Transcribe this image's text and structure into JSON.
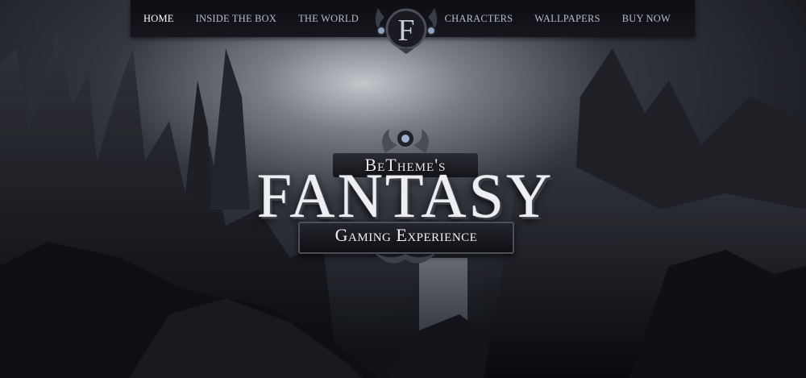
{
  "nav": {
    "left": [
      {
        "label": "HOME",
        "active": true
      },
      {
        "label": "INSIDE THE BOX",
        "active": false
      },
      {
        "label": "THE WORLD",
        "active": false
      }
    ],
    "right": [
      {
        "label": "CHARACTERS",
        "active": false
      },
      {
        "label": "WALLPAPERS",
        "active": false
      },
      {
        "label": "BUY NOW",
        "active": false
      }
    ]
  },
  "emblem": {
    "letter": "F",
    "icon": "f-emblem-icon"
  },
  "hero": {
    "brand": "BeTheme's",
    "title": "FANTASY",
    "subtitle": "Gaming Experience"
  },
  "colors": {
    "background": "#1b1d24",
    "nav_bg": "#111217",
    "nav_text": "#b8bcc8",
    "nav_active": "#ffffff",
    "title": "#eceef2"
  }
}
